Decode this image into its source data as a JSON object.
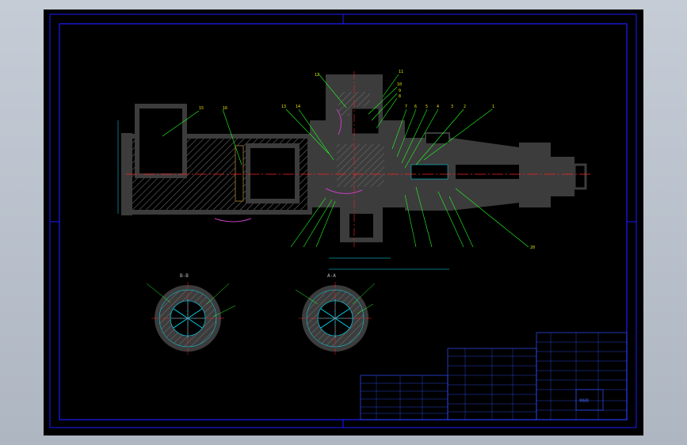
{
  "app": {
    "title": ""
  },
  "colors": {
    "paper": "#000000",
    "frame": "#1a1aff",
    "body": "#3c3c3c",
    "hatch": "#6a6a6a",
    "leader": "#22ff22",
    "centerline": "#ff2020",
    "dimension": "#00e5ff",
    "label": "#e6e600",
    "table_lines": "#2f4fff",
    "outer_background": "#b8c0cb"
  },
  "section_titles": {
    "left": "B-B",
    "right": "A-A"
  },
  "part_labels": [
    {
      "id": "b1",
      "text": "15"
    },
    {
      "id": "b2",
      "text": "16"
    },
    {
      "id": "b3",
      "text": "12"
    },
    {
      "id": "b4",
      "text": "11"
    },
    {
      "id": "b5",
      "text": "10"
    },
    {
      "id": "b6",
      "text": "9"
    },
    {
      "id": "b7",
      "text": "8"
    },
    {
      "id": "b8",
      "text": "7"
    },
    {
      "id": "b9",
      "text": "6"
    },
    {
      "id": "b10",
      "text": "5"
    },
    {
      "id": "b11",
      "text": "4"
    },
    {
      "id": "b12",
      "text": "3"
    },
    {
      "id": "b13",
      "text": "2"
    },
    {
      "id": "b14",
      "text": "1"
    },
    {
      "id": "b15",
      "text": "13"
    },
    {
      "id": "b16",
      "text": "14"
    },
    {
      "id": "b17",
      "text": "20"
    }
  ],
  "title_block": {
    "main_cell": "装配图"
  }
}
